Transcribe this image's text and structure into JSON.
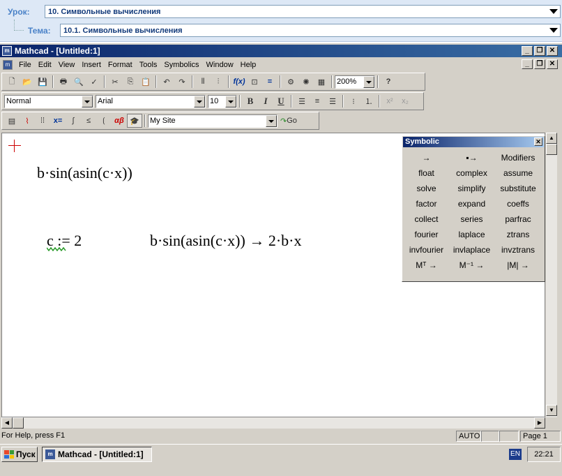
{
  "lesson": {
    "lesson_label": "Урок:",
    "lesson_value": "10. Символьные вычисления",
    "topic_label": "Тема:",
    "topic_value": "10.1. Символьные вычисления"
  },
  "window": {
    "title": "Mathcad - [Untitled:1]",
    "menu": [
      "File",
      "Edit",
      "View",
      "Insert",
      "Format",
      "Tools",
      "Symbolics",
      "Window",
      "Help"
    ]
  },
  "toolbar": {
    "zoom": "200%",
    "style": "Normal",
    "font": "Arial",
    "font_size": "10",
    "bold": "B",
    "italic": "I",
    "underline": "U",
    "site": "My Site",
    "go": "Go"
  },
  "worksheet": {
    "expr1": "b·sin(asin(c·x))",
    "assign": "c := 2",
    "expr2": "b·sin(asin(c·x)) → 2·b·x"
  },
  "palette": {
    "title": "Symbolic",
    "items": [
      "→",
      "▪→",
      "Modifiers",
      "float",
      "complex",
      "assume",
      "solve",
      "simplify",
      "substitute",
      "factor",
      "expand",
      "coeffs",
      "collect",
      "series",
      "parfrac",
      "fourier",
      "laplace",
      "ztrans",
      "invfourier",
      "invlaplace",
      "invztrans",
      "Mᵀ →",
      "M⁻¹ →",
      "|M| →"
    ]
  },
  "status": {
    "help": "For Help, press F1",
    "mode": "AUTO",
    "page": "Page 1"
  },
  "taskbar": {
    "start": "Пуск",
    "task": "Mathcad - [Untitled:1]",
    "lang": "EN",
    "clock": "22:21"
  }
}
